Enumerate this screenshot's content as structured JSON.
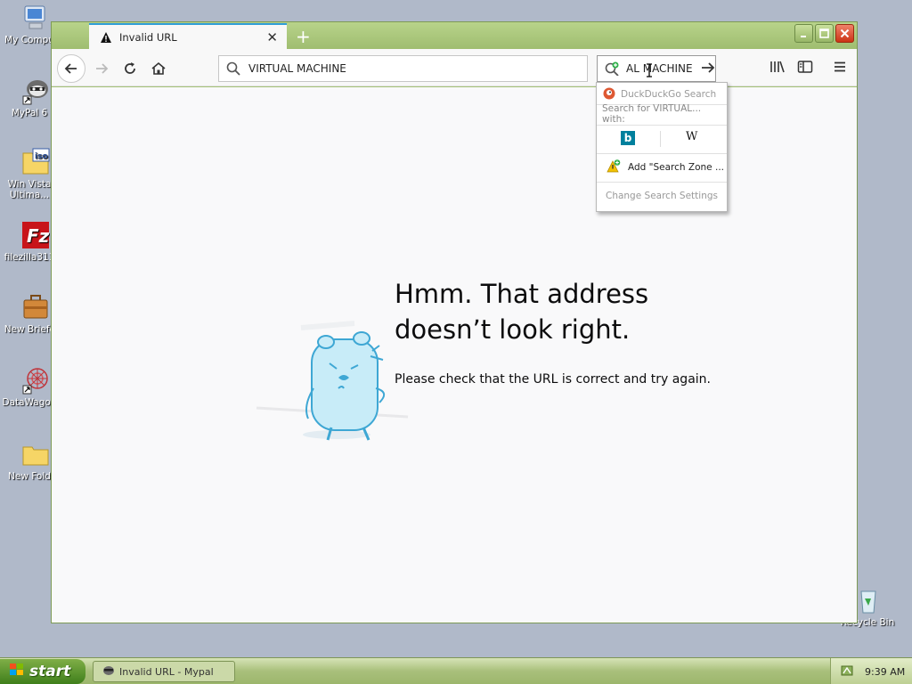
{
  "desktop": {
    "icons": [
      {
        "label": "My Compu"
      },
      {
        "label": "MyPal 6"
      },
      {
        "label": "Win Vista Ultima..."
      },
      {
        "label": "filezilla311"
      },
      {
        "label": "New Briefc"
      },
      {
        "label": "DataWagon"
      },
      {
        "label": "New Fold"
      }
    ],
    "recycle_bin": "Recycle Bin"
  },
  "browser": {
    "tab_title": "Invalid URL",
    "url_value": "VIRTUAL MACHINE",
    "search_value": "AL MACHINE"
  },
  "search_dropdown": {
    "engine": "DuckDuckGo Search",
    "search_for": "Search for VIRTUAL... with:",
    "alt_engines": [
      "b",
      "W"
    ],
    "add_engine": "Add \"Search Zone ...",
    "change_settings": "Change Search Settings"
  },
  "error_page": {
    "title_line1": "Hmm. That address",
    "title_line2": "doesn’t look right.",
    "message": "Please check that the URL is correct and try again."
  },
  "taskbar": {
    "start_label": "start",
    "task_item": "Invalid URL - Mypal",
    "clock": "9:39 AM"
  },
  "colors": {
    "window_frame": "#a4c276",
    "tab_accent": "#2f9dd6",
    "close_button": "#cc3315"
  }
}
